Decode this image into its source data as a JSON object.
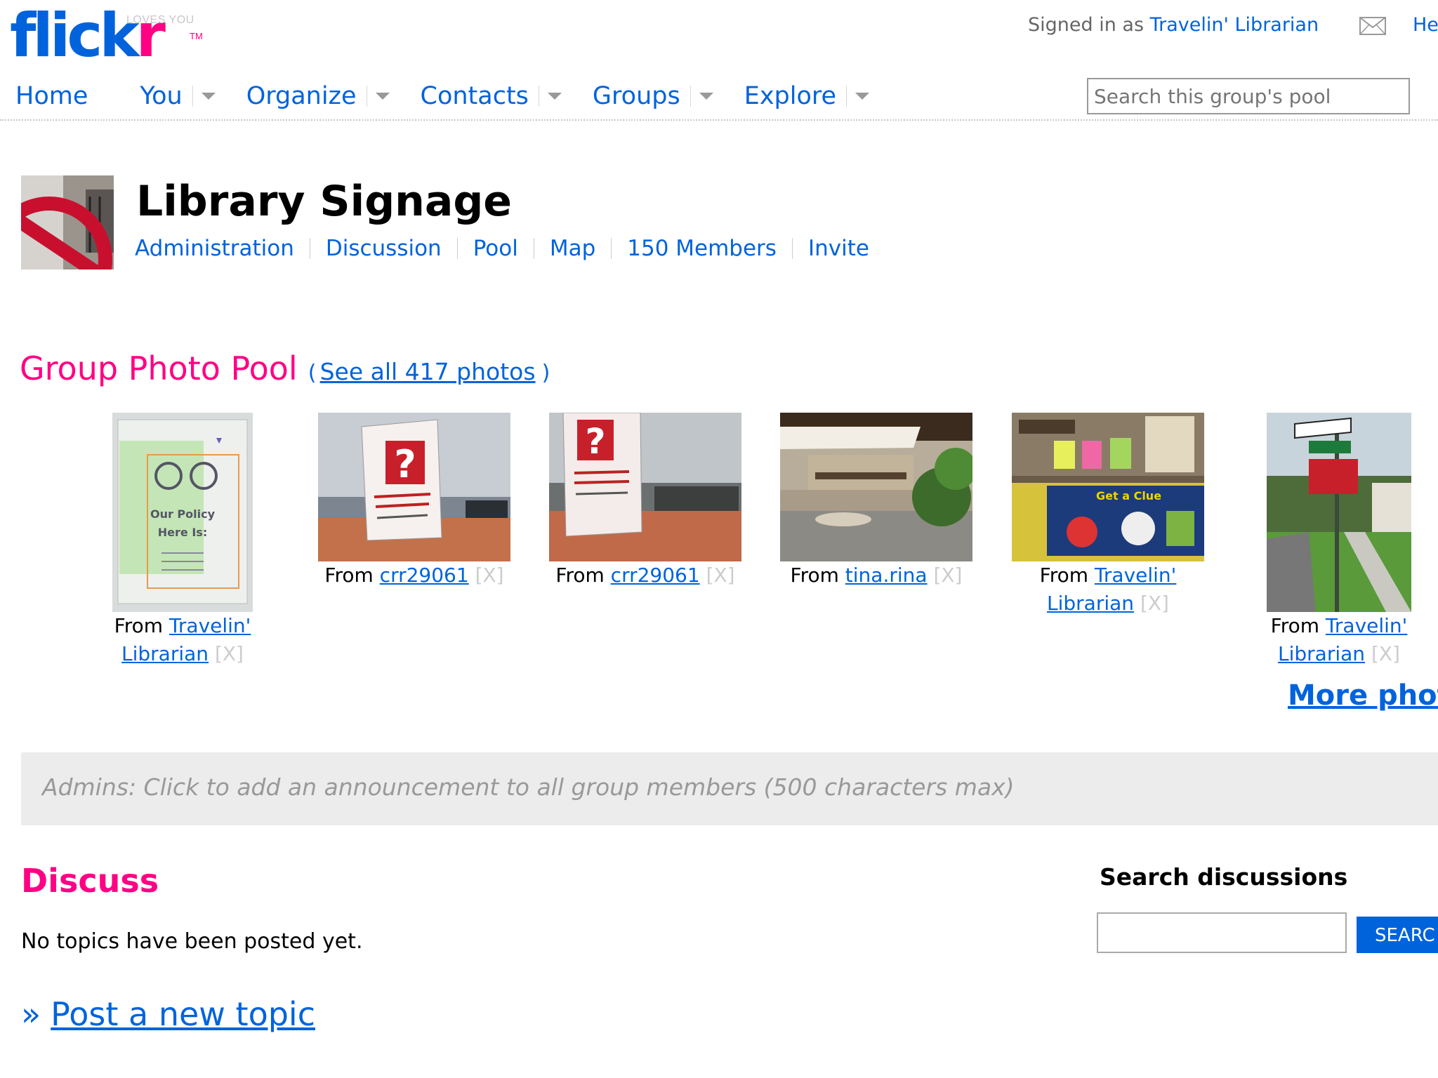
{
  "header": {
    "logo_text": "flick",
    "logo_text_r": "r",
    "logo_tagline": "LOVES YOU",
    "logo_tm": "TM",
    "signed_in_prefix": "Signed in as ",
    "signed_in_user": "Travelin' Librarian",
    "help_label": "He",
    "mail_icon": "envelope-icon"
  },
  "nav": {
    "items": [
      {
        "label": "Home",
        "dropdown": false
      },
      {
        "label": "You",
        "dropdown": true
      },
      {
        "label": "Organize",
        "dropdown": true
      },
      {
        "label": "Contacts",
        "dropdown": true
      },
      {
        "label": "Groups",
        "dropdown": true
      },
      {
        "label": "Explore",
        "dropdown": true
      }
    ],
    "search_placeholder": "Search this group's pool"
  },
  "group": {
    "title": "Library Signage",
    "links": [
      "Administration",
      "Discussion",
      "Pool",
      "Map",
      "150 Members",
      "Invite"
    ]
  },
  "pool": {
    "heading": "Group Photo Pool",
    "paren_open": "(",
    "see_all": "See all 417 photos",
    "paren_close": ")",
    "photos": [
      {
        "from": "From ",
        "user_line1": "Travelin'",
        "user_line2": "Librarian",
        "remove": "[X]",
        "image": "policy-sign-photo"
      },
      {
        "from": "From ",
        "user_line1": "crr29061",
        "remove": "[X]",
        "image": "question-sign-photo"
      },
      {
        "from": "From ",
        "user_line1": "crr29061",
        "remove": "[X]",
        "image": "question-sign-table-photo"
      },
      {
        "from": "From ",
        "user_line1": "tina.rina",
        "remove": "[X]",
        "image": "library-entrance-photo"
      },
      {
        "from": "From ",
        "user_line1": "Travelin'",
        "user_line2": "Librarian",
        "remove": "[X]",
        "image": "get-a-clue-display-photo"
      },
      {
        "from": "From ",
        "user_line1": "Travelin'",
        "user_line2": "Librarian",
        "remove": "[X]",
        "image": "street-sign-photo"
      }
    ],
    "more_photos": "More photo"
  },
  "announcement": "Admins: Click to add an announcement to all group members (500 characters max)",
  "discuss": {
    "heading": "Discuss",
    "no_topics": "No topics have been posted yet.",
    "post_prefix": "»",
    "post_new_topic": "Post a new topic",
    "search_heading": "Search discussions",
    "search_button": "SEARC"
  }
}
